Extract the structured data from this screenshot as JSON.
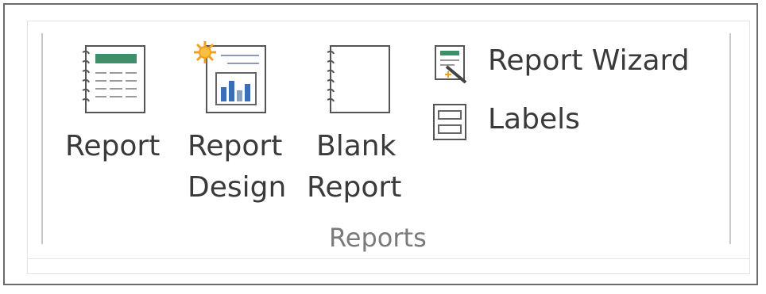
{
  "ribbon": {
    "group_label": "Reports",
    "buttons": {
      "report": {
        "label": "Report",
        "icon": "report-icon"
      },
      "report_design": {
        "line1": "Report",
        "line2": "Design",
        "icon": "report-design-icon"
      },
      "blank_report": {
        "line1": "Blank",
        "line2": "Report",
        "icon": "blank-report-icon"
      },
      "report_wizard": {
        "label": "Report Wizard",
        "icon": "report-wizard-icon"
      },
      "labels": {
        "label": "Labels",
        "icon": "labels-icon"
      }
    }
  },
  "colors": {
    "header_green": "#3f8f6a",
    "sun_orange": "#f0a020",
    "chart_blue": "#3a6fb7",
    "text": "#3a3a3a",
    "group_label": "#7a7a7a"
  }
}
